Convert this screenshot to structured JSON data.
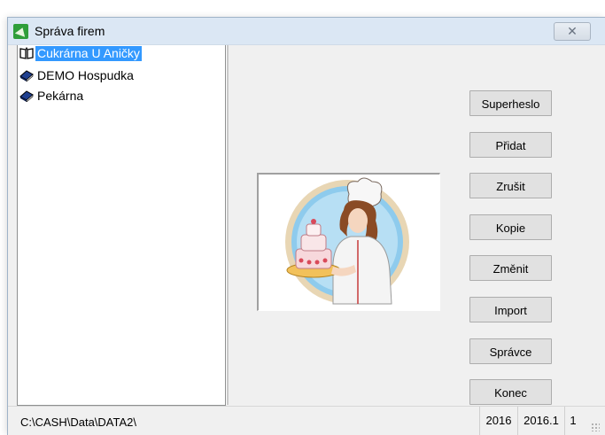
{
  "window": {
    "title": "Správa firem",
    "close_symbol": "✕"
  },
  "tree": {
    "items": [
      {
        "label": "Cukrárna U Aničky",
        "selected": true,
        "icon": "open-book-icon"
      },
      {
        "label": "DEMO Hospudka",
        "selected": false,
        "icon": "closed-book-icon"
      },
      {
        "label": "Pekárna",
        "selected": false,
        "icon": "closed-book-icon"
      }
    ]
  },
  "buttons": {
    "superheslo": "Superheslo",
    "pridat": "Přidat",
    "zrusit": "Zrušit",
    "kopie": "Kopie",
    "zmenit": "Změnit",
    "import": "Import",
    "spravce": "Správce",
    "konec": "Konec"
  },
  "picture": {
    "subject": "pastry chef holding a cake",
    "accent_color": "#6fb6e3"
  },
  "status": {
    "path": "C:\\CASH\\Data\\DATA2\\",
    "year": "2016",
    "version": "2016.1",
    "number": "1"
  },
  "colors": {
    "selection": "#3399ff",
    "titlebar": "#dbe7f4"
  }
}
